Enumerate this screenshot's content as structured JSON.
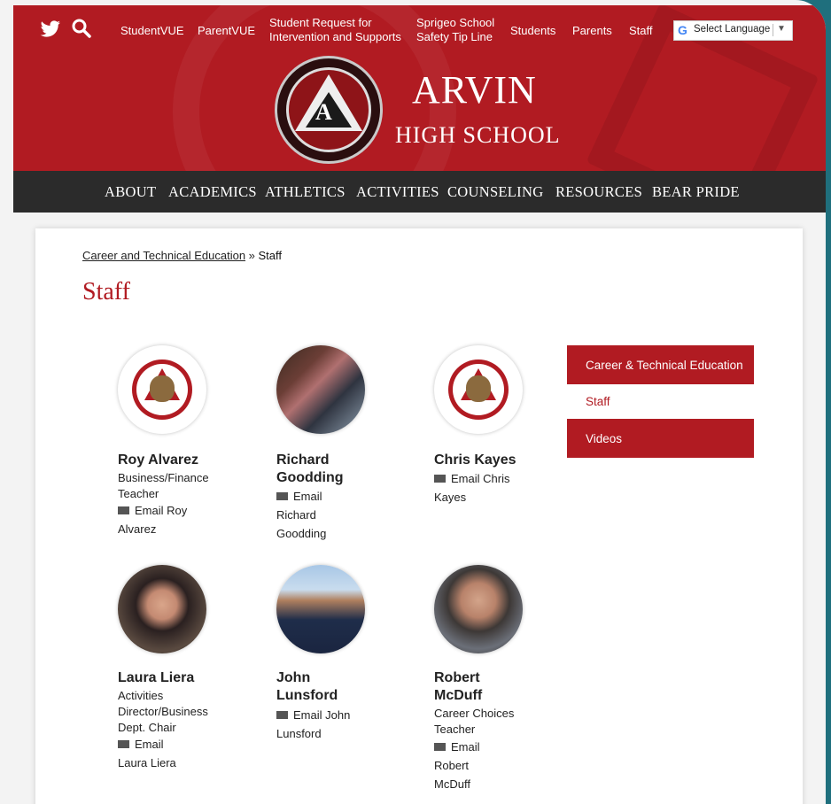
{
  "top_nav": {
    "twitter_icon": "twitter-icon",
    "search_icon": "search-icon",
    "links": [
      "StudentVUE",
      "ParentVUE",
      "Student Request for\nIntervention and Supports",
      "Sprigeo School\nSafety Tip Line",
      "Students",
      "Parents",
      "Staff"
    ],
    "language_select": "Select Language"
  },
  "header": {
    "school_name_line1": "ARVIN",
    "school_name_line2": "HIGH SCHOOL",
    "seal_letter": "A"
  },
  "main_nav": [
    "ABOUT",
    "ACADEMICS",
    "ATHLETICS",
    "ACTIVITIES",
    "COUNSELING",
    "RESOURCES",
    "BEAR PRIDE"
  ],
  "breadcrumb": {
    "parent": "Career and Technical Education",
    "separator": " » ",
    "current": "Staff"
  },
  "page_title": "Staff",
  "staff": [
    {
      "name": "Roy Alvarez",
      "title": "Business/Finance Teacher",
      "email_label": "Email Roy Alvarez",
      "photo": "school-logo"
    },
    {
      "name": "Richard Goodding",
      "title": "",
      "email_label": "Email Richard Goodding",
      "photo": "person-photo"
    },
    {
      "name": "Chris Kayes",
      "title": "",
      "email_label": "Email Chris Kayes",
      "photo": "school-logo"
    },
    {
      "name": "Laura Liera",
      "title": "Activities Director/Business Dept. Chair",
      "email_label": "Email Laura Liera",
      "photo": "person-photo"
    },
    {
      "name": "John Lunsford",
      "title": "",
      "email_label": "Email John Lunsford",
      "photo": "person-photo"
    },
    {
      "name": "Robert McDuff",
      "title": "Career Choices Teacher",
      "email_label": "Email Robert McDuff",
      "photo": "person-photo"
    }
  ],
  "sidebar": {
    "items": [
      "Career & Technical Education",
      "Staff",
      "Videos"
    ],
    "active": "Staff"
  },
  "colors": {
    "brand_red": "#b11b22",
    "nav_dark": "#2b2b2b"
  }
}
